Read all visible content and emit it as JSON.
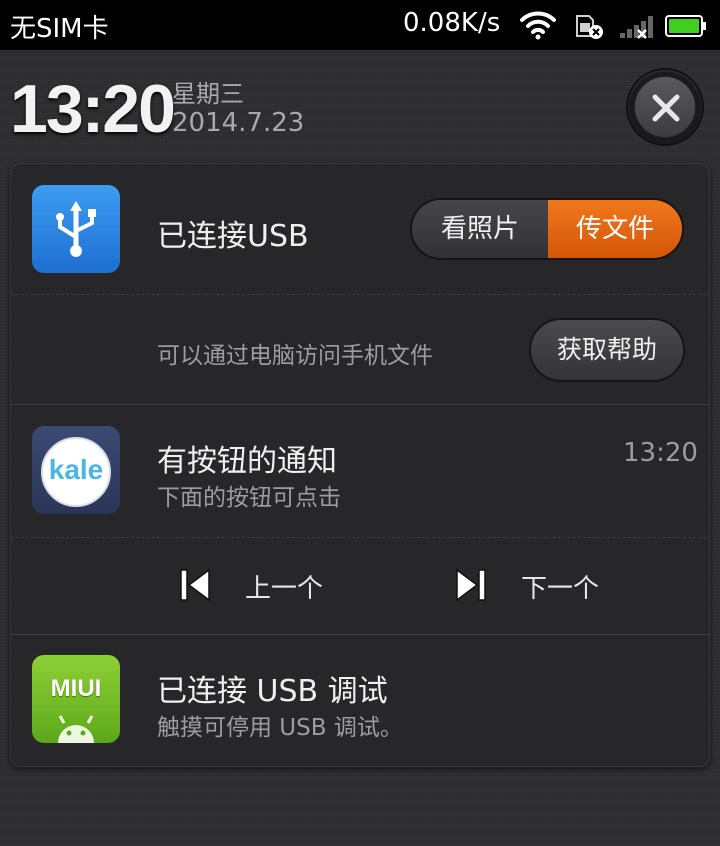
{
  "status_bar": {
    "carrier": "无SIM卡",
    "speed": "0.08K/s",
    "icons": [
      "wifi-icon",
      "sim-icon",
      "signal-icon",
      "battery-icon"
    ],
    "battery_color": "#3fcf1e"
  },
  "header": {
    "time": "13:20",
    "weekday": "星期三",
    "date": "2014.7.23",
    "close_icon": "close-icon"
  },
  "notifications": {
    "usb": {
      "title": "已连接USB",
      "description": "可以通过电脑访问手机文件",
      "options": [
        "看照片",
        "传文件"
      ],
      "selected_option": "传文件",
      "help_label": "获取帮助",
      "accent": "#e8680f"
    },
    "kale": {
      "icon_text": "kale",
      "title": "有按钮的通知",
      "subtitle": "下面的按钮可点击",
      "time": "13:20",
      "prev_label": "上一个",
      "next_label": "下一个"
    },
    "debug": {
      "icon_text": "MIUI",
      "title": "已连接 USB 调试",
      "subtitle": "触摸可停用 USB 调试。"
    }
  }
}
